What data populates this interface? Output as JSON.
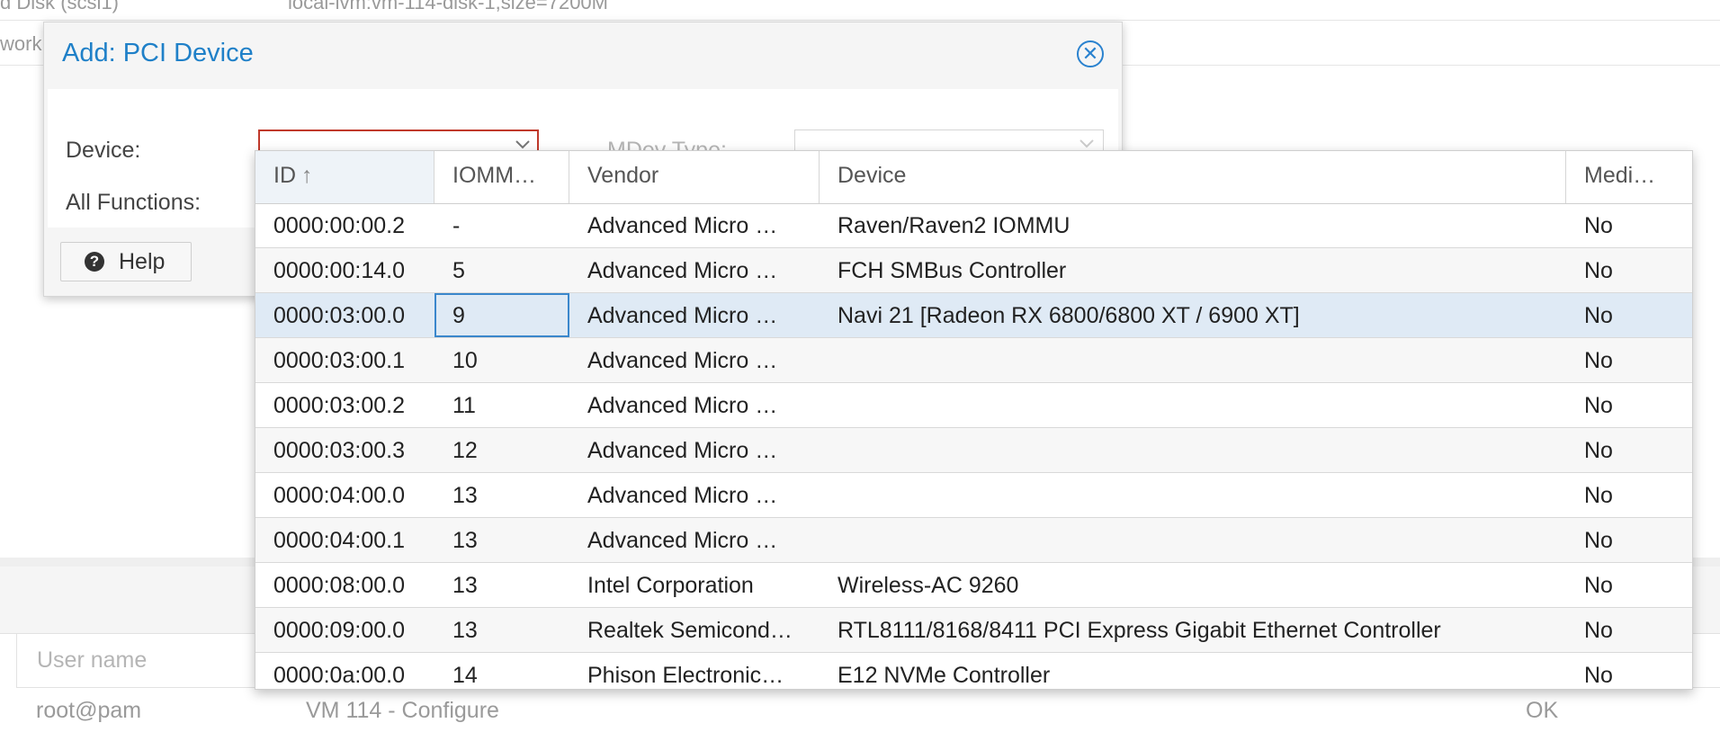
{
  "background": {
    "rows": [
      {
        "label": "d Disk (scsi1)",
        "value": "local-lvm:vm-114-disk-1,size=7200M"
      },
      {
        "label": "work"
      }
    ],
    "user_column_header": "User name",
    "bottom_row": {
      "user": "root@pam",
      "description": "VM 114 - Configure",
      "status": "OK"
    }
  },
  "dialog": {
    "title": "Add: PCI Device",
    "close_icon": "close-circle-icon",
    "device_label": "Device:",
    "device_value": "",
    "mdev_label": "MDev Type:",
    "mdev_value": "",
    "all_functions_label": "All Functions:",
    "help_label": "Help",
    "help_icon": "question-circle-icon"
  },
  "grid": {
    "columns": [
      "ID",
      "IOMM…",
      "Vendor",
      "Device",
      "Medi…"
    ],
    "sort_icon": "arrow-up-icon",
    "rows": [
      {
        "id": "0000:00:00.2",
        "iommu": "-",
        "vendor": "Advanced Micro …",
        "device": "Raven/Raven2 IOMMU",
        "mdev": "No"
      },
      {
        "id": "0000:00:14.0",
        "iommu": "5",
        "vendor": "Advanced Micro …",
        "device": "FCH SMBus Controller",
        "mdev": "No"
      },
      {
        "id": "0000:03:00.0",
        "iommu": "9",
        "vendor": "Advanced Micro …",
        "device": "Navi 21 [Radeon RX 6800/6800 XT / 6900 XT]",
        "mdev": "No"
      },
      {
        "id": "0000:03:00.1",
        "iommu": "10",
        "vendor": "Advanced Micro …",
        "device": "",
        "mdev": "No"
      },
      {
        "id": "0000:03:00.2",
        "iommu": "11",
        "vendor": "Advanced Micro …",
        "device": "",
        "mdev": "No"
      },
      {
        "id": "0000:03:00.3",
        "iommu": "12",
        "vendor": "Advanced Micro …",
        "device": "",
        "mdev": "No"
      },
      {
        "id": "0000:04:00.0",
        "iommu": "13",
        "vendor": "Advanced Micro …",
        "device": "",
        "mdev": "No"
      },
      {
        "id": "0000:04:00.1",
        "iommu": "13",
        "vendor": "Advanced Micro …",
        "device": "",
        "mdev": "No"
      },
      {
        "id": "0000:08:00.0",
        "iommu": "13",
        "vendor": "Intel Corporation",
        "device": "Wireless-AC 9260",
        "mdev": "No"
      },
      {
        "id": "0000:09:00.0",
        "iommu": "13",
        "vendor": "Realtek Semicond…",
        "device": "RTL8111/8168/8411 PCI Express Gigabit Ethernet Controller",
        "mdev": "No"
      },
      {
        "id": "0000:0a:00.0",
        "iommu": "14",
        "vendor": "Phison Electronic…",
        "device": "E12 NVMe Controller",
        "mdev": "No"
      }
    ]
  },
  "colors": {
    "accent": "#1f80c8",
    "invalid_border": "#c0392b",
    "selected_row": "#dfeaf5",
    "focus_border": "#3a87cc"
  }
}
